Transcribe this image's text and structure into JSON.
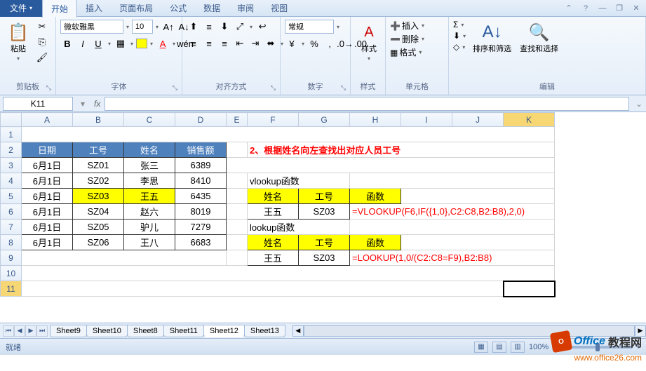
{
  "tabs": {
    "file": "文件",
    "home": "开始",
    "insert": "插入",
    "layout": "页面布局",
    "formulas": "公式",
    "data": "数据",
    "review": "审阅",
    "view": "视图"
  },
  "ribbon": {
    "clipboard": {
      "label": "剪贴板",
      "paste": "粘贴"
    },
    "font": {
      "label": "字体",
      "name": "微软雅黑",
      "size": "10",
      "b": "B",
      "i": "I",
      "u": "U"
    },
    "align": {
      "label": "对齐方式"
    },
    "number": {
      "label": "数字",
      "format": "常规"
    },
    "style": {
      "label": "样式",
      "btn": "样式"
    },
    "cells": {
      "label": "单元格",
      "insert": "插入",
      "delete": "删除",
      "format": "格式"
    },
    "editing": {
      "label": "编辑",
      "sort": "排序和筛选",
      "find": "查找和选择",
      "sum": "Σ",
      "fill": "⬇",
      "clear": "◇"
    }
  },
  "name_box": "K11",
  "fx_label": "fx",
  "columns": [
    "A",
    "B",
    "C",
    "D",
    "E",
    "F",
    "G",
    "H",
    "I",
    "J",
    "K"
  ],
  "rows": [
    "1",
    "2",
    "3",
    "4",
    "5",
    "6",
    "7",
    "8",
    "9",
    "10",
    "11"
  ],
  "table1": {
    "headers": [
      "日期",
      "工号",
      "姓名",
      "销售额"
    ],
    "rows": [
      [
        "6月1日",
        "SZ01",
        "张三",
        "6389"
      ],
      [
        "6月1日",
        "SZ02",
        "李思",
        "8410"
      ],
      [
        "6月1日",
        "SZ03",
        "王五",
        "6435"
      ],
      [
        "6月1日",
        "SZ04",
        "赵六",
        "8019"
      ],
      [
        "6月1日",
        "SZ05",
        "驴儿",
        "7279"
      ],
      [
        "6月1日",
        "SZ06",
        "王八",
        "6683"
      ]
    ]
  },
  "title2": "2、根据姓名向左查找出对应人员工号",
  "vlookup_label": "vlookup函数",
  "lookup_label": "lookup函数",
  "mini_headers": [
    "姓名",
    "工号",
    "函数"
  ],
  "vlookup_row": [
    "王五",
    "SZ03"
  ],
  "vlookup_formula": "=VLOOKUP(F6,IF({1,0},C2:C8,B2:B8),2,0)",
  "lookup_row": [
    "王五",
    "SZ03"
  ],
  "lookup_formula": "=LOOKUP(1,0/(C2:C8=F9),B2:B8)",
  "sheets": [
    "Sheet9",
    "Sheet10",
    "Sheet8",
    "Sheet11",
    "Sheet12",
    "Sheet13"
  ],
  "status": "就绪",
  "zoom": "100%",
  "zoom_minus": "−",
  "zoom_plus": "+",
  "watermark": {
    "brand1": "Office",
    "brand2": "教程网",
    "url": "www.office26.com"
  }
}
